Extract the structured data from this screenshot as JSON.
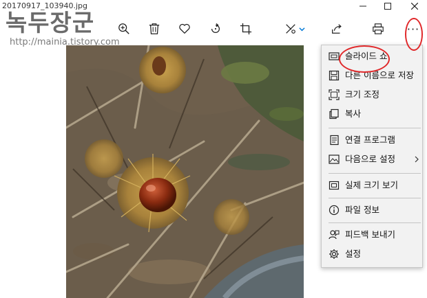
{
  "window": {
    "filename": "20170917_103940.jpg",
    "minimize": "—",
    "maximize": "□",
    "close": "✕"
  },
  "watermark": {
    "title": "녹두장군",
    "url": "http://mainia.tistory.com"
  },
  "toolbar": {
    "icons": [
      "zoom-in-icon",
      "delete-icon",
      "favorite-icon",
      "rotate-icon",
      "crop-icon",
      "edit-icon",
      "share-icon",
      "print-icon",
      "more-icon"
    ],
    "more_label": "···"
  },
  "menu": {
    "items": [
      {
        "label": "슬라이드 쇼",
        "icon": "slideshow-icon"
      },
      {
        "label": "다른 이름으로 저장",
        "icon": "save-icon"
      },
      {
        "label": "크기 조정",
        "icon": "resize-icon"
      },
      {
        "label": "복사",
        "icon": "copy-icon"
      },
      {
        "label": "연결 프로그램",
        "icon": "open-with-icon"
      },
      {
        "label": "다음으로 설정",
        "icon": "set-as-icon"
      },
      {
        "label": "실제 크기 보기",
        "icon": "actual-size-icon"
      },
      {
        "label": "파일 정보",
        "icon": "info-icon"
      },
      {
        "label": "피드백 보내기",
        "icon": "feedback-icon"
      },
      {
        "label": "설정",
        "icon": "settings-icon"
      }
    ]
  },
  "colors": {
    "accent": "#0078d7",
    "annotation": "#e0282a",
    "menu_bg": "#f2f2f2"
  }
}
